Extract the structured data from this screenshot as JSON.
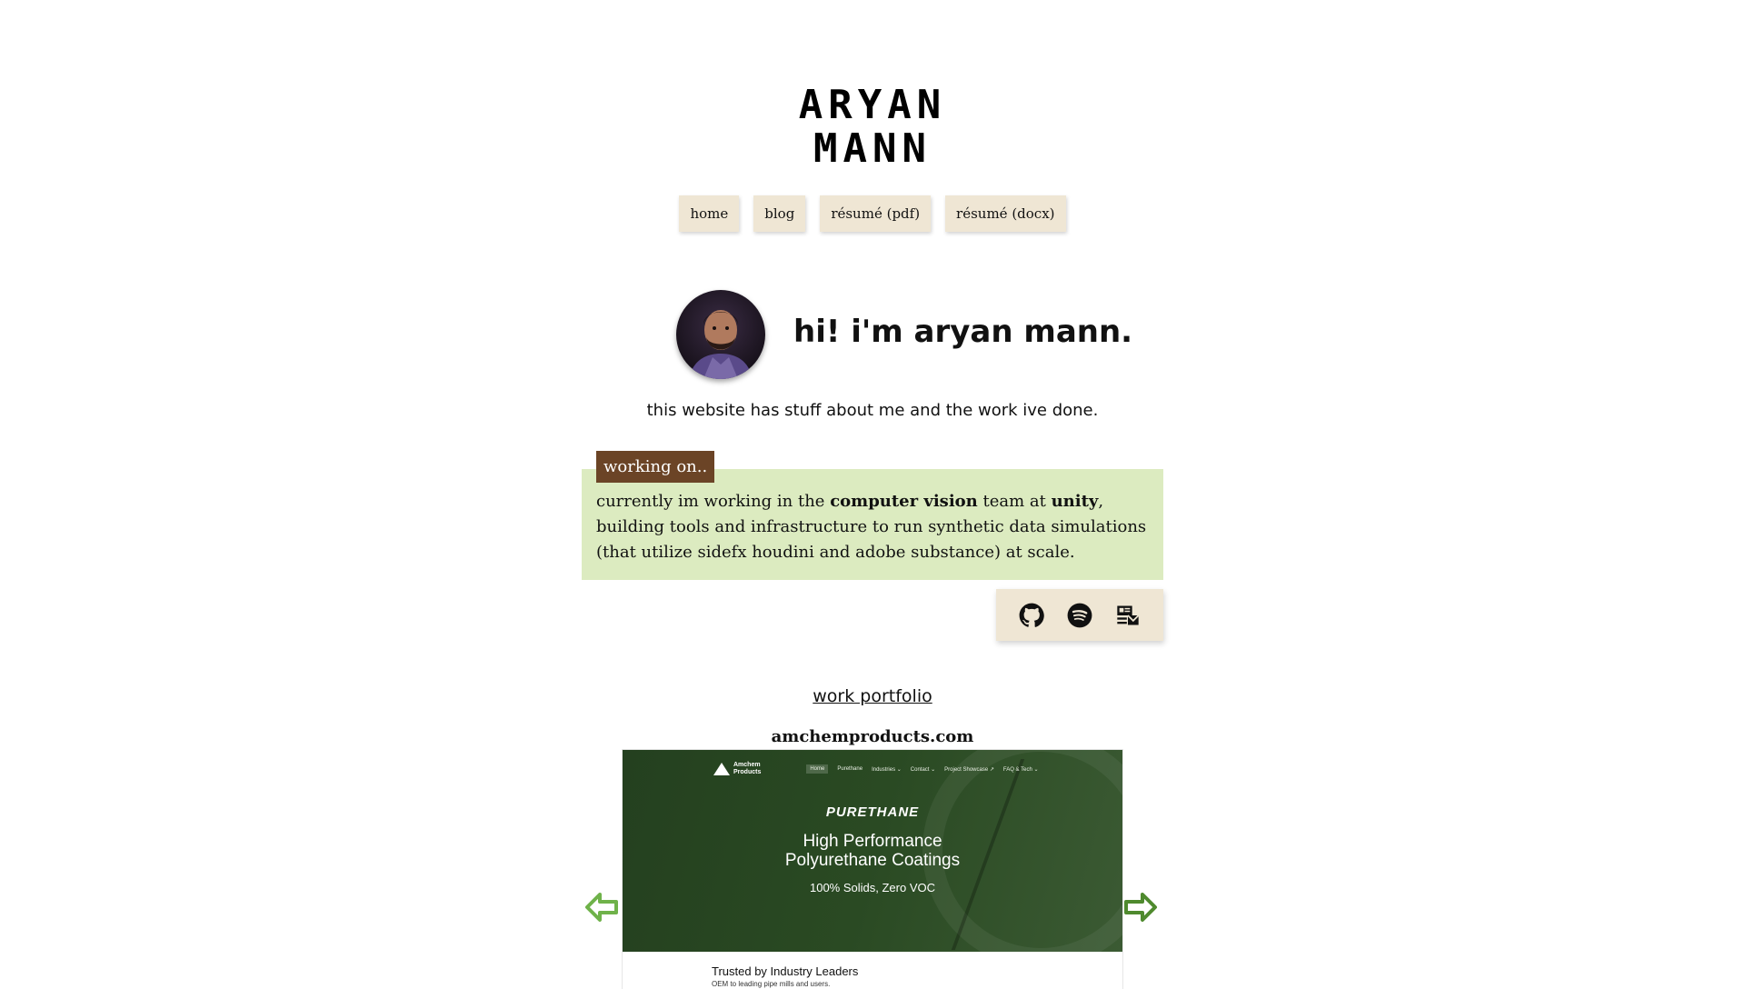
{
  "header": {
    "title_line1": "ARYAN",
    "title_line2": "MANN"
  },
  "nav": {
    "items": [
      {
        "label": "home"
      },
      {
        "label": "blog"
      },
      {
        "label": "résumé (pdf)"
      },
      {
        "label": "résumé (docx)"
      }
    ]
  },
  "intro": {
    "greeting": "hi! i'm aryan mann.",
    "tagline": "this website has stuff about me and the work ive done."
  },
  "working_on": {
    "label": "working on..",
    "text_before_cv": "currently im working in the ",
    "cv_team": "computer vision",
    "text_team_at": " team at ",
    "company": "unity",
    "text_after": ", building tools and infrastructure to run synthetic data simulations (that utilize sidefx houdini and adobe substance) at scale."
  },
  "socials": {
    "icons": [
      "github-icon",
      "spotify-icon",
      "contact-card-icon"
    ]
  },
  "portfolio": {
    "link_label": "work portfolio",
    "site_name": "amchemproducts.com",
    "preview": {
      "logo_text_1": "Amchem",
      "logo_text_2": "Products",
      "nav_items": [
        "Home",
        "Purethane",
        "Industries ⌄",
        "Contact ⌄",
        "Project Showcase ↗",
        "FAQ & Tech ⌄"
      ],
      "brand": "PURETHANE",
      "headline_1": "High Performance",
      "headline_2": "Polyurethane Coatings",
      "subheadline": "100% Solids, Zero VOC",
      "trusted_title": "Trusted by Industry Leaders",
      "trusted_sub": "OEM to leading pipe mills and users."
    }
  },
  "colors": {
    "nav_bg": "#efe6d4",
    "working_box_bg": "#dcebc0",
    "working_label_bg": "#6b4426",
    "arrow_green": "#6fb24a",
    "hero_green": "#2a4a23"
  }
}
